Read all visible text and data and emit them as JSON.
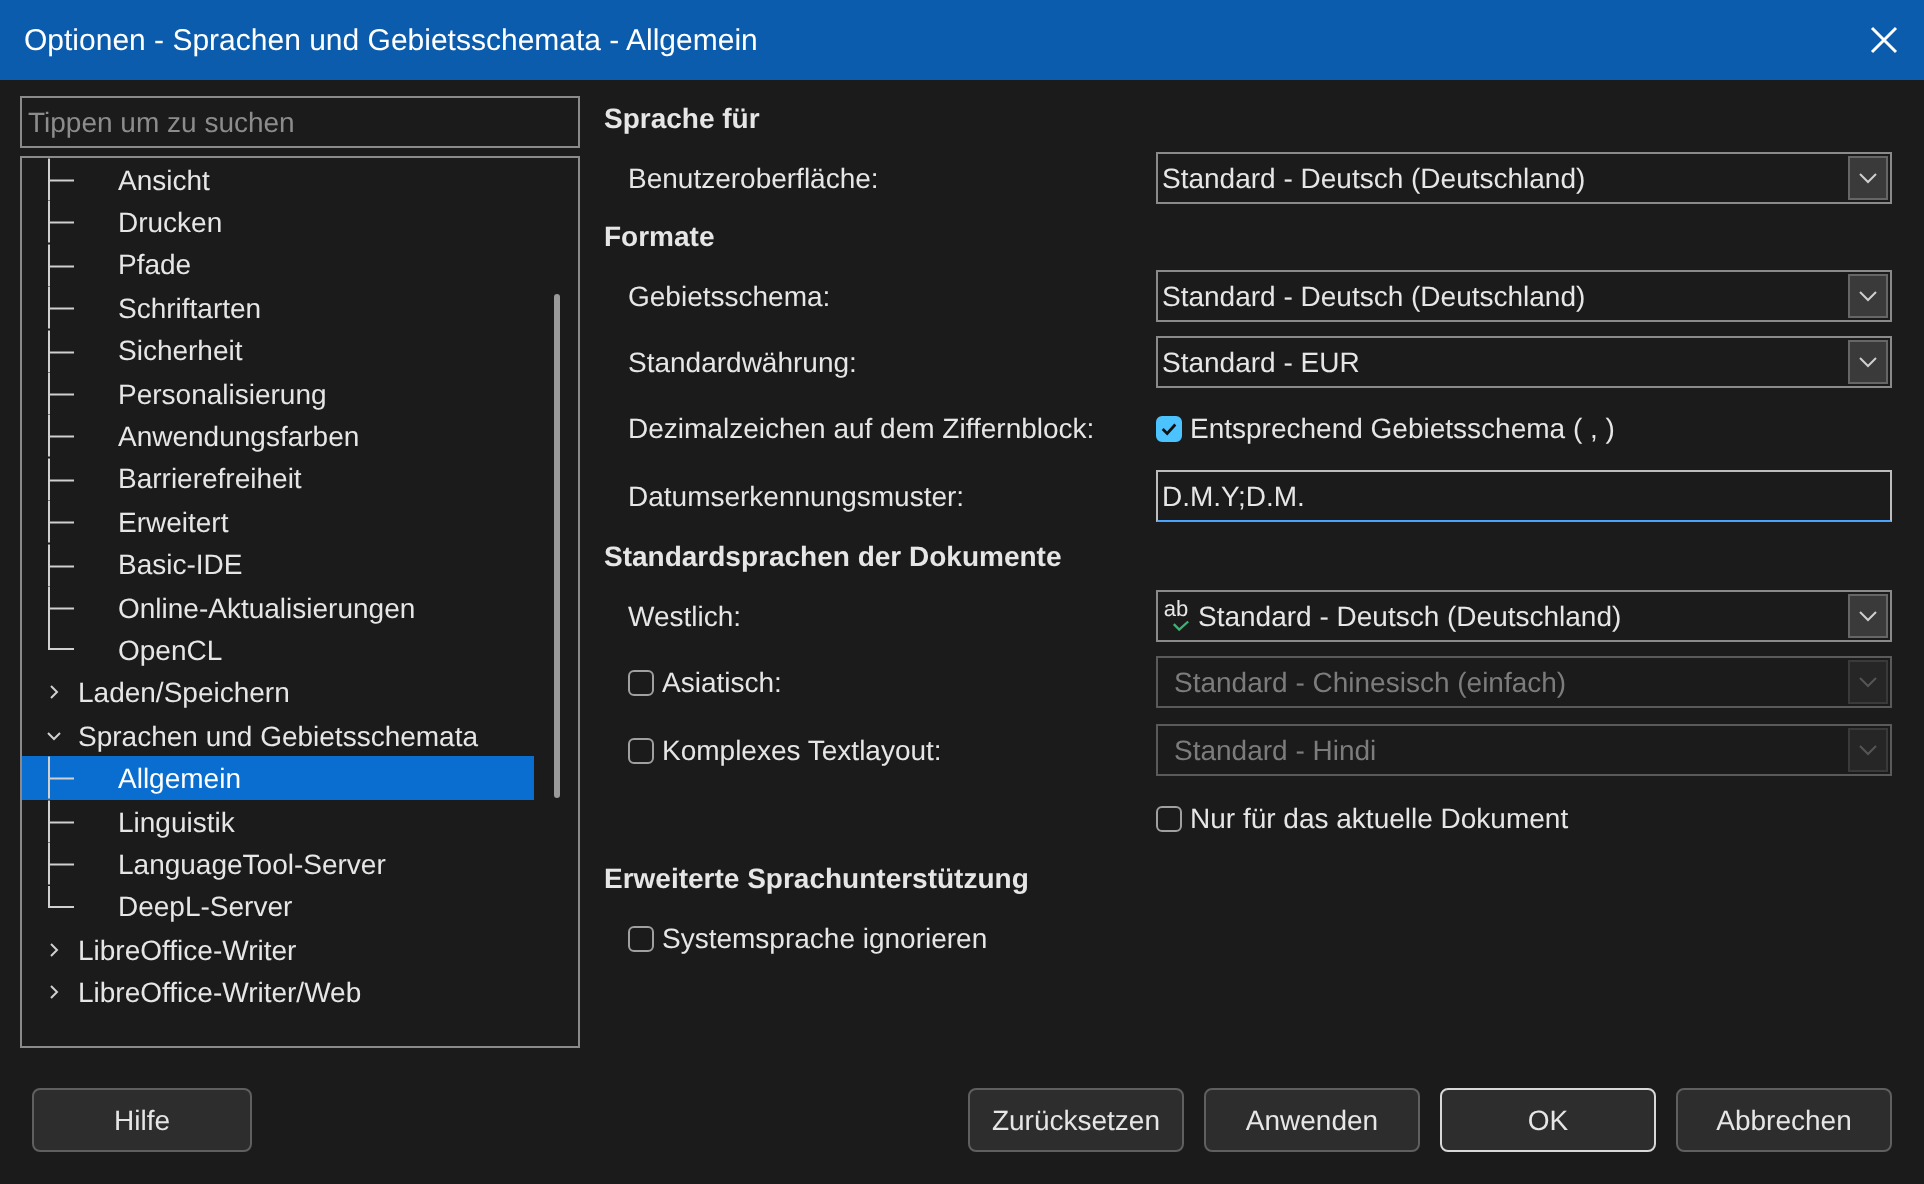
{
  "window": {
    "title": "Optionen - Sprachen und Gebietsschemata - Allgemein"
  },
  "search": {
    "placeholder": "Tippen um zu suchen"
  },
  "tree": {
    "continued_children": [
      {
        "label": "Ansicht",
        "selected": false
      },
      {
        "label": "Drucken",
        "selected": false
      },
      {
        "label": "Pfade",
        "selected": false
      },
      {
        "label": "Schriftarten",
        "selected": false
      },
      {
        "label": "Sicherheit",
        "selected": false
      },
      {
        "label": "Personalisierung",
        "selected": false
      },
      {
        "label": "Anwendungsfarben",
        "selected": false
      },
      {
        "label": "Barrierefreiheit",
        "selected": false
      },
      {
        "label": "Erweitert",
        "selected": false
      },
      {
        "label": "Basic-IDE",
        "selected": false
      },
      {
        "label": "Online-Aktualisierungen",
        "selected": false
      },
      {
        "label": "OpenCL",
        "selected": false
      }
    ],
    "items": [
      {
        "label": "Laden/Speichern",
        "expanded": false,
        "selected": false
      },
      {
        "label": "Sprachen und Gebietsschemata",
        "expanded": true,
        "selected": false,
        "children": [
          {
            "label": "Allgemein",
            "selected": true
          },
          {
            "label": "Linguistik",
            "selected": false
          },
          {
            "label": "LanguageTool-Server",
            "selected": false
          },
          {
            "label": "DeepL-Server",
            "selected": false
          }
        ]
      },
      {
        "label": "LibreOffice-Writer",
        "expanded": false,
        "selected": false
      },
      {
        "label": "LibreOffice-Writer/Web",
        "expanded": false,
        "selected": false
      }
    ]
  },
  "sections": [
    {
      "title": "Sprache für",
      "rows": [
        {
          "kind": "combo",
          "label": "Benutzeroberfläche:",
          "value": "Standard - Deutsch (Deutschland)",
          "disabled": false
        }
      ]
    },
    {
      "title": "Formate",
      "rows": [
        {
          "kind": "combo",
          "label": "Gebietsschema:",
          "value": "Standard - Deutsch (Deutschland)",
          "disabled": false
        },
        {
          "kind": "combo",
          "label": "Standardwährung:",
          "value": "Standard - EUR",
          "disabled": false
        },
        {
          "kind": "option",
          "label": "Dezimalzeichen auf dem Ziffernblock:",
          "option": "Entsprechend Gebietsschema ( , )",
          "checked": true
        },
        {
          "kind": "text",
          "label": "Datumserkennungsmuster:",
          "value": "D.M.Y;D.M."
        }
      ]
    },
    {
      "title": "Standardsprachen der Dokumente",
      "rows": [
        {
          "kind": "combo",
          "label": "Westlich:",
          "value": "Standard - Deutsch (Deutschland)",
          "disabled": false,
          "icon_text": "ab"
        },
        {
          "kind": "checkcombo",
          "label": "Asiatisch:",
          "checked": false,
          "value": "Standard - Chinesisch (einfach)",
          "disabled": true
        },
        {
          "kind": "checkcombo",
          "label": "Komplexes Textlayout:",
          "checked": false,
          "value": "Standard - Hindi",
          "disabled": true
        },
        {
          "kind": "option",
          "option": "Nur für das aktuelle Dokument",
          "checked": false
        }
      ]
    },
    {
      "title": "Erweiterte Sprachunterstützung",
      "rows": [
        {
          "kind": "check",
          "option": "Systemsprache ignorieren",
          "checked": false
        }
      ]
    }
  ],
  "buttons_left": [
    {
      "label": "Hilfe",
      "default": false
    }
  ],
  "buttons_right": [
    {
      "label": "Zurücksetzen",
      "default": false
    },
    {
      "label": "Anwenden",
      "default": false
    },
    {
      "label": "OK",
      "default": true
    },
    {
      "label": "Abbrechen",
      "default": false
    }
  ]
}
